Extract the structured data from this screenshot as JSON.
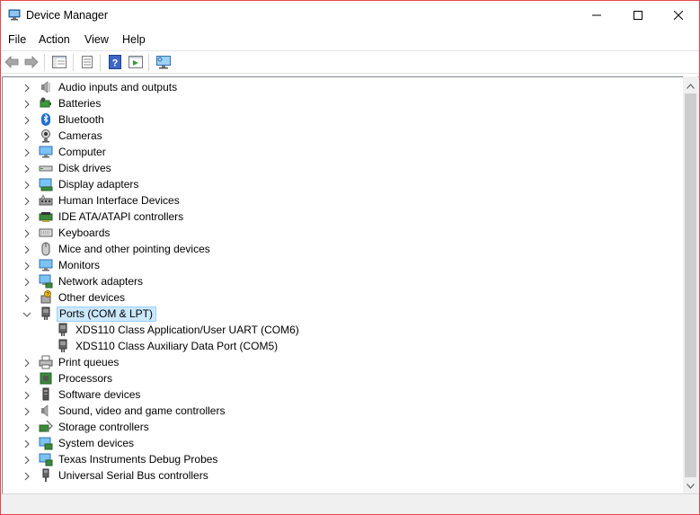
{
  "window": {
    "title": "Device Manager",
    "border_color": "#e8454a"
  },
  "menu": [
    {
      "label": "File",
      "icon": null
    },
    {
      "label": "Action",
      "icon": null
    },
    {
      "label": "View",
      "icon": null
    },
    {
      "label": "Help",
      "icon": null
    }
  ],
  "toolbar": {
    "buttons": [
      "back-arrow-icon",
      "forward-arrow-icon",
      "show-hide-tree-icon",
      "properties-icon",
      "help-icon",
      "run-icon",
      "monitor-scan-icon"
    ]
  },
  "tree": {
    "categories": [
      {
        "label": "Audio inputs and outputs",
        "icon": "speaker-icon",
        "expanded": false
      },
      {
        "label": "Batteries",
        "icon": "battery-icon",
        "expanded": false
      },
      {
        "label": "Bluetooth",
        "icon": "bluetooth-icon",
        "expanded": false
      },
      {
        "label": "Cameras",
        "icon": "camera-icon",
        "expanded": false
      },
      {
        "label": "Computer",
        "icon": "computer-icon",
        "expanded": false
      },
      {
        "label": "Disk drives",
        "icon": "disk-drive-icon",
        "expanded": false
      },
      {
        "label": "Display adapters",
        "icon": "display-adapter-icon",
        "expanded": false
      },
      {
        "label": "Human Interface Devices",
        "icon": "hid-icon",
        "expanded": false
      },
      {
        "label": "IDE ATA/ATAPI controllers",
        "icon": "ide-controller-icon",
        "expanded": false
      },
      {
        "label": "Keyboards",
        "icon": "keyboard-icon",
        "expanded": false
      },
      {
        "label": "Mice and other pointing devices",
        "icon": "mouse-icon",
        "expanded": false
      },
      {
        "label": "Monitors",
        "icon": "monitor-icon",
        "expanded": false
      },
      {
        "label": "Network adapters",
        "icon": "network-adapter-icon",
        "expanded": false
      },
      {
        "label": "Other devices",
        "icon": "other-devices-icon",
        "expanded": false
      },
      {
        "label": "Ports (COM & LPT)",
        "icon": "port-icon",
        "expanded": true,
        "selected": true,
        "children": [
          {
            "label": "XDS110 Class Application/User UART (COM6)",
            "icon": "port-icon"
          },
          {
            "label": "XDS110 Class Auxiliary Data Port (COM5)",
            "icon": "port-icon"
          }
        ]
      },
      {
        "label": "Print queues",
        "icon": "printer-icon",
        "expanded": false
      },
      {
        "label": "Processors",
        "icon": "processor-icon",
        "expanded": false
      },
      {
        "label": "Software devices",
        "icon": "software-device-icon",
        "expanded": false
      },
      {
        "label": "Sound, video and game controllers",
        "icon": "sound-icon",
        "expanded": false
      },
      {
        "label": "Storage controllers",
        "icon": "storage-controller-icon",
        "expanded": false
      },
      {
        "label": "System devices",
        "icon": "system-device-icon",
        "expanded": false
      },
      {
        "label": "Texas Instruments Debug Probes",
        "icon": "debug-probe-icon",
        "expanded": false
      },
      {
        "label": "Universal Serial Bus controllers",
        "icon": "usb-icon",
        "expanded": false
      }
    ]
  },
  "colors": {
    "selection_bg": "#cce8ff",
    "selection_border": "#99d1ff"
  }
}
